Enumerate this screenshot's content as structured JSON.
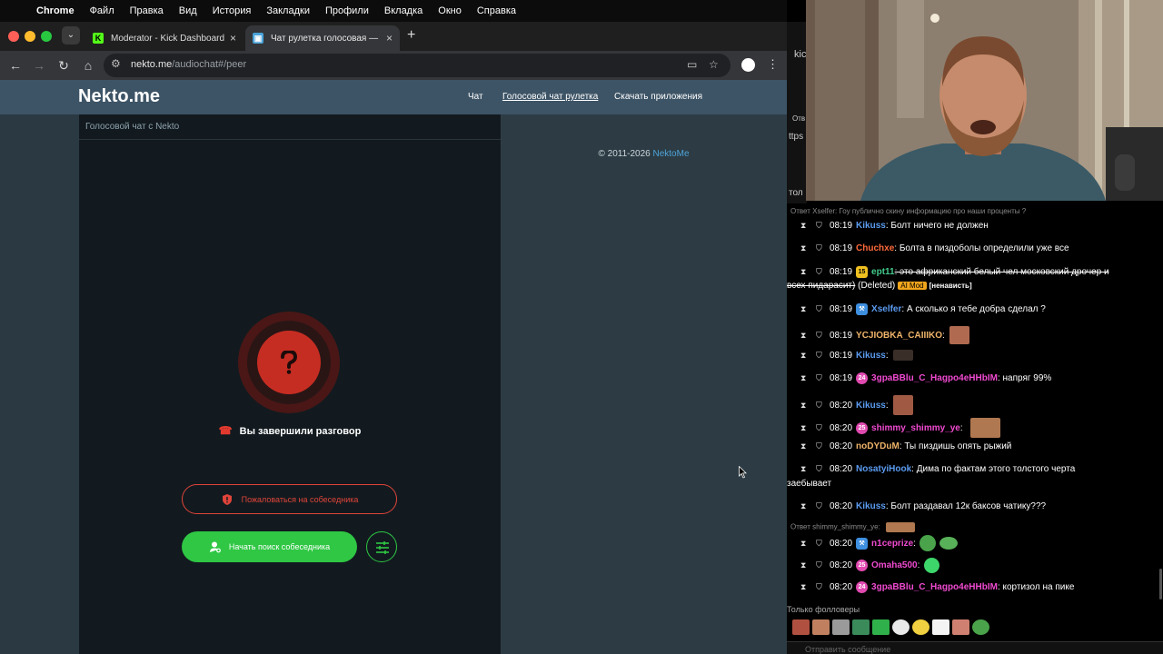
{
  "menubar": {
    "app": "Chrome",
    "items": [
      "Файл",
      "Правка",
      "Вид",
      "История",
      "Закладки",
      "Профили",
      "Вкладка",
      "Окно",
      "Справка"
    ]
  },
  "browser": {
    "tabs": [
      {
        "title": "Moderator - Kick Dashboard",
        "favicon": "kick-icon"
      },
      {
        "title": "Чат рулетка голосовая — Nekto.me",
        "favicon": "nekto-icon"
      }
    ],
    "url_host": "nekto.me",
    "url_path": "/audiochat#/peer"
  },
  "site": {
    "logo": "Nekto.me",
    "nav": [
      "Чат",
      "Голосовой чат рулетка",
      "Скачать приложения"
    ],
    "chat_title": "Голосовой чат с Nekto",
    "status_text": "Вы завершили разговор",
    "report_button": "Пожаловаться на собеседника",
    "search_button": "Начать поиск собеседника",
    "copyright_text": "© 2011-2026",
    "copyright_link": "NektoMe"
  },
  "side": {
    "behind_text": [
      "kic",
      "Отв",
      "ttps",
      "тол"
    ],
    "reply_1": "Ответ Xselfer: Гоу публично скину информацию про наши проценты ?",
    "reply_2": "Ответ shimmy_shimmy_ye:",
    "followers_label": "Только фолловеры",
    "send_placeholder": "Отправить сообщение",
    "messages": [
      {
        "time": "08:19",
        "user": "Kikuss",
        "color": "#5b9bf0",
        "text": ": Болт ничего не должен"
      },
      {
        "time": "08:19",
        "user": "Chuchxe",
        "color": "#ff6a3d",
        "text": ": Болта в пиздоболы определили уже все"
      },
      {
        "time": "08:19",
        "user": "ept11",
        "color": "#42c98a",
        "badge": "15",
        "text": ": это африканский белый чел московский дрочер и",
        "cont": "всех пидарасит)"
      },
      {
        "time": "08:19",
        "user": "Xselfer",
        "color": "#5b9bf0",
        "text": ": А сколько я тебе добра сделал ?"
      },
      {
        "time": "08:19",
        "user": "YCJIOBKA_CAIIIKO",
        "color": "#f0b46a",
        "text": ":"
      },
      {
        "time": "08:19",
        "user": "Kikuss",
        "color": "#5b9bf0",
        "text": ":"
      },
      {
        "time": "08:19",
        "user": "3gpaBBlu_C_Hagpo4eHHbIM",
        "color": "#f04ad0",
        "text": ": напряг 99%"
      },
      {
        "time": "08:20",
        "user": "Kikuss",
        "color": "#5b9bf0",
        "text": ":"
      },
      {
        "time": "08:20",
        "user": "shimmy_shimmy_ye",
        "color": "#f04ad0",
        "text": ":"
      },
      {
        "time": "08:20",
        "user": "noDYDuM",
        "color": "#f0b46a",
        "text": ": Ты пиздишь опять рыжий"
      },
      {
        "time": "08:20",
        "user": "NosatyiHook",
        "color": "#5b9bf0",
        "text": ": Дима по фактам этого толстого черта",
        "cont": "заебывает"
      },
      {
        "time": "08:20",
        "user": "Kikuss",
        "color": "#5b9bf0",
        "text": ": Болт раздавал 12к баксов чатику???"
      },
      {
        "time": "08:20",
        "user": "n1ceprize",
        "color": "#f04ad0",
        "text": ":"
      },
      {
        "time": "08:20",
        "user": "Omaha500",
        "color": "#f04ad0",
        "text": ":"
      },
      {
        "time": "08:20",
        "user": "3gpaBBlu_C_Hagpo4eHHbIM",
        "color": "#f04ad0",
        "text": ": кортизол на пике"
      }
    ],
    "deleted_label": "(Deleted)",
    "ai_mod_label": "AI Mod",
    "hate_label": "[ненависть]"
  }
}
